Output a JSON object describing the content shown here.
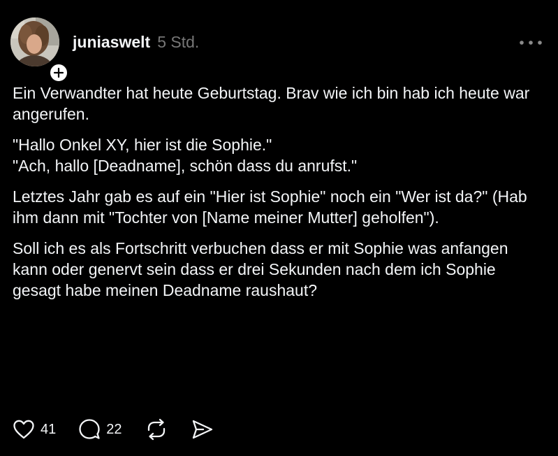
{
  "post": {
    "author": {
      "username": "juniaswelt",
      "avatar_icon": "profile-photo",
      "follow_icon": "plus-icon"
    },
    "timestamp": "5 Std.",
    "more_icon": "more-horizontal-icon",
    "paragraphs": [
      "Ein Verwandter hat heute Geburtstag. Brav wie ich bin hab ich heute war angerufen.",
      "\"Hallo Onkel XY, hier ist die Sophie.\"\n\"Ach, hallo [Deadname], schön dass du anrufst.\"",
      "Letztes Jahr gab es auf ein \"Hier ist Sophie\" noch ein \"Wer ist da?\" (Hab ihm dann mit \"Tochter von [Name meiner Mutter] geholfen\").",
      "Soll ich es als Fortschritt verbuchen dass er mit Sophie was anfangen kann oder genervt sein dass er drei Sekunden nach dem ich Sophie gesagt habe meinen Deadname raushaut?"
    ],
    "actions": {
      "like": {
        "icon": "heart-icon",
        "count": "41"
      },
      "reply": {
        "icon": "comment-icon",
        "count": "22"
      },
      "repost": {
        "icon": "repost-icon"
      },
      "share": {
        "icon": "send-icon"
      }
    }
  },
  "colors": {
    "background": "#000000",
    "text": "#f3f5f7",
    "muted": "#777777"
  }
}
